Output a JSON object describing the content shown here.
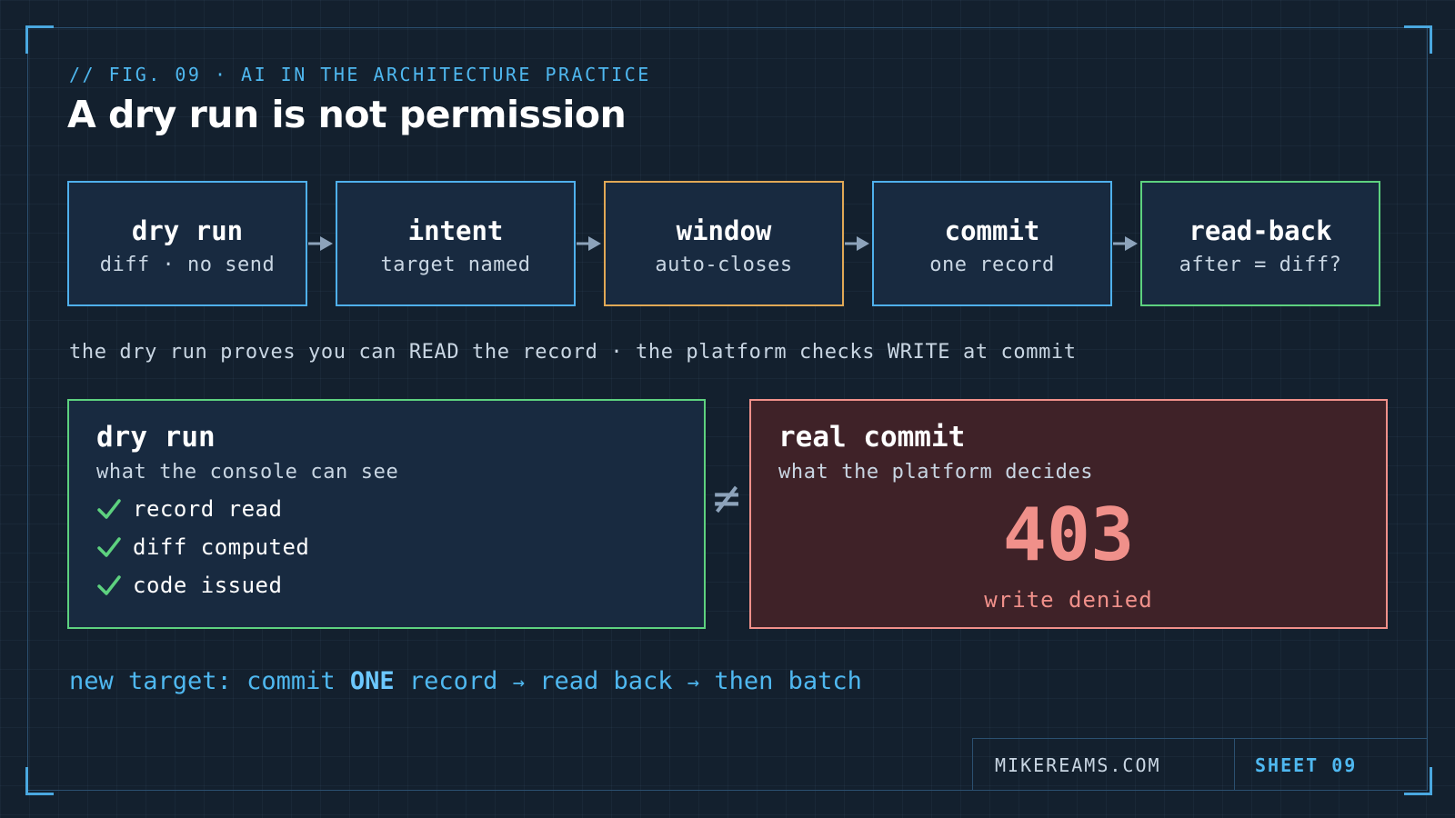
{
  "header": {
    "eyebrow": "// FIG. 09 · AI IN THE ARCHITECTURE PRACTICE",
    "title": "A dry run is not permission"
  },
  "pipeline": [
    {
      "title": "dry run",
      "subtitle": "diff · no send",
      "color": "#4fb0ec"
    },
    {
      "title": "intent",
      "subtitle": "target named",
      "color": "#4fb0ec"
    },
    {
      "title": "window",
      "subtitle": "auto-closes",
      "color": "#e0a855"
    },
    {
      "title": "commit",
      "subtitle": "one record",
      "color": "#4fb0ec"
    },
    {
      "title": "read-back",
      "subtitle": "after = diff?",
      "color": "#5dd17f"
    }
  ],
  "note": "the dry run proves you can READ the record · the platform checks WRITE at commit",
  "left_panel": {
    "title": "dry run",
    "subtitle": "what the console can see",
    "checks": [
      "record read",
      "diff computed",
      "code issued"
    ],
    "border_color": "#5dd17f"
  },
  "not_equal_symbol": "≠",
  "right_panel": {
    "title": "real commit",
    "subtitle": "what the platform decides",
    "code": "403",
    "caption": "write denied",
    "border_color": "#f0908a"
  },
  "target_line": {
    "lead": "new target: commit ",
    "emphasis": "ONE",
    "rest": " record",
    "arrow": "→",
    "step2": "read back",
    "step3": "then batch"
  },
  "footer": {
    "site": "MIKEREAMS.COM",
    "sheet": "SHEET 09"
  },
  "colors": {
    "background": "#13202e",
    "accent_blue": "#4fb8f0",
    "amber": "#e0a855",
    "green": "#5dd17f",
    "red": "#f0908a"
  }
}
